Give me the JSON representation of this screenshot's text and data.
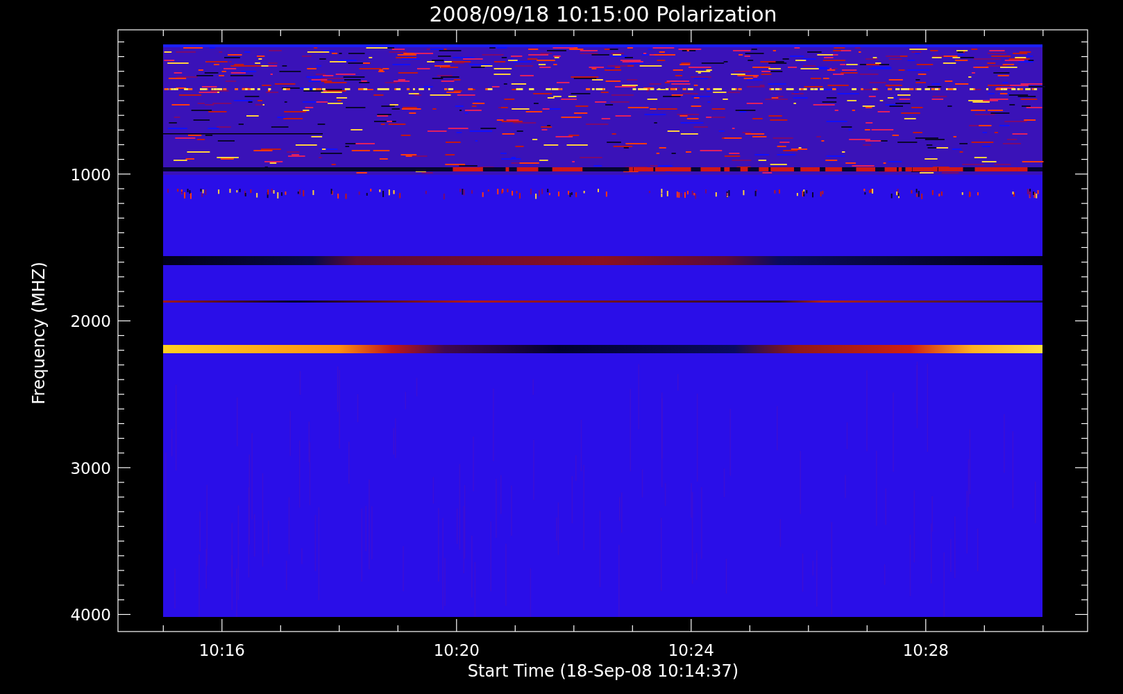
{
  "title": "2008/09/18 10:15:00 Polarization",
  "y_axis": {
    "label": "Frequency (MHZ)",
    "ticks": [
      "1000",
      "2000",
      "3000",
      "4000"
    ]
  },
  "x_axis": {
    "label": "Start Time (18-Sep-08 10:14:37)",
    "ticks": [
      "10:16",
      "10:20",
      "10:24",
      "10:28"
    ]
  }
}
